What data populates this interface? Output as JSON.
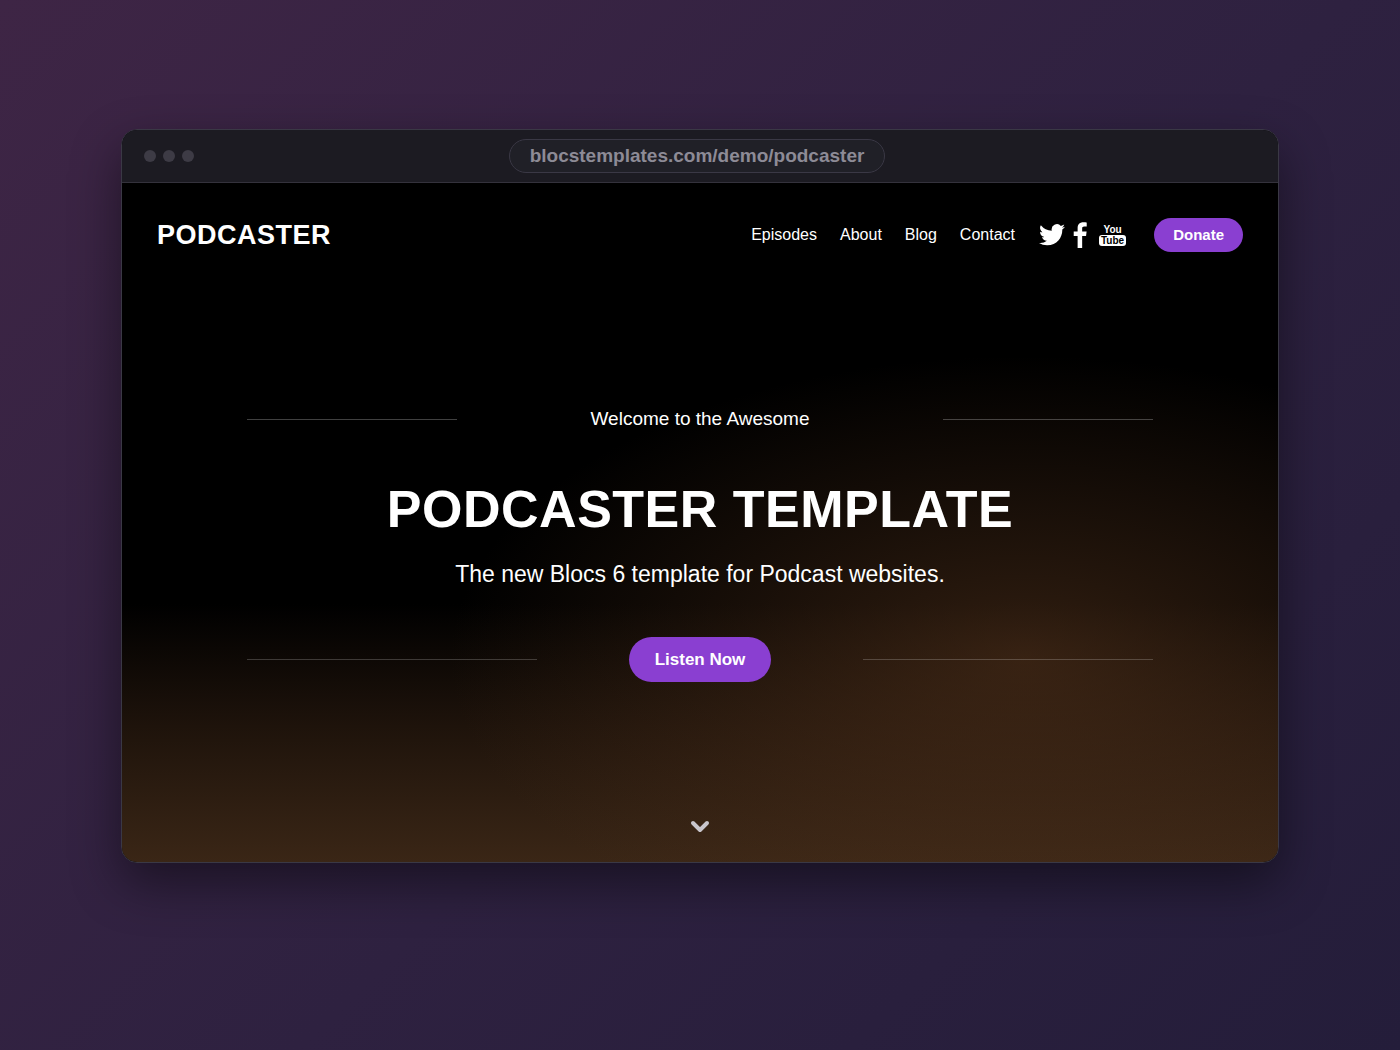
{
  "browser": {
    "url": "blocstemplates.com/demo/podcaster"
  },
  "nav": {
    "logo": "PODCASTER",
    "links": [
      "Episodes",
      "About",
      "Blog",
      "Contact"
    ],
    "youtube": {
      "top": "You",
      "bottom": "Tube"
    },
    "donate": "Donate"
  },
  "hero": {
    "kicker": "Welcome to the Awesome",
    "title": "PODCASTER TEMPLATE",
    "subtitle": "The new Blocs 6 template for Podcast websites.",
    "cta": "Listen Now"
  }
}
